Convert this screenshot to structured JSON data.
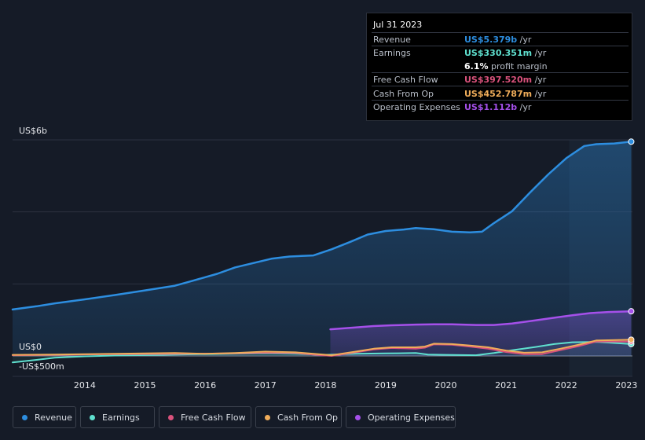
{
  "chart_data": {
    "type": "line",
    "x_ticks": [
      "2014",
      "2015",
      "2016",
      "2017",
      "2018",
      "2019",
      "2020",
      "2021",
      "2022",
      "2023"
    ],
    "y_ticks": [
      {
        "label": "US$6b",
        "value": 6000
      },
      {
        "label": "US$0",
        "value": 0
      },
      {
        "label": "-US$500m",
        "value": -500
      }
    ],
    "ylim": [
      -550,
      6000
    ],
    "xlim": [
      2013.3,
      2023.6
    ],
    "forecast_start": 2022.55,
    "series": [
      {
        "name": "Revenue",
        "color": "#2d8ee0",
        "fill": true,
        "x": [
          2013.3,
          2013.7,
          2014.0,
          2014.5,
          2015.0,
          2015.5,
          2016.0,
          2016.3,
          2016.7,
          2017.0,
          2017.3,
          2017.6,
          2017.9,
          2018.3,
          2018.6,
          2018.9,
          2019.2,
          2019.5,
          2019.8,
          2020.0,
          2020.3,
          2020.6,
          2020.9,
          2021.1,
          2021.3,
          2021.6,
          2021.9,
          2022.2,
          2022.5,
          2022.8,
          2023.0,
          2023.3,
          2023.58
        ],
        "y": [
          1290,
          1380,
          1460,
          1570,
          1690,
          1820,
          1950,
          2090,
          2280,
          2460,
          2580,
          2700,
          2760,
          2790,
          2960,
          3160,
          3370,
          3470,
          3510,
          3550,
          3520,
          3450,
          3430,
          3450,
          3690,
          4020,
          4540,
          5040,
          5490,
          5830,
          5880,
          5900,
          5950
        ]
      },
      {
        "name": "Earnings",
        "color": "#5fe0cf",
        "fill": false,
        "x": [
          2013.3,
          2013.7,
          2014.0,
          2014.5,
          2015.0,
          2015.5,
          2016.0,
          2016.5,
          2017.0,
          2017.5,
          2018.0,
          2018.5,
          2019.0,
          2019.5,
          2020.0,
          2020.2,
          2020.5,
          2021.0,
          2021.3,
          2021.6,
          2022.0,
          2022.3,
          2022.6,
          2023.0,
          2023.58
        ],
        "y": [
          -180,
          -110,
          -50,
          -10,
          10,
          25,
          40,
          50,
          60,
          70,
          60,
          30,
          60,
          70,
          80,
          40,
          30,
          20,
          80,
          160,
          250,
          330,
          380,
          390,
          330
        ]
      },
      {
        "name": "Free Cash Flow",
        "color": "#d9527c",
        "fill": false,
        "x": [
          2013.3,
          2014.0,
          2015.0,
          2016.0,
          2017.0,
          2017.5,
          2018.0,
          2018.3,
          2018.6,
          2019.0,
          2019.3,
          2019.6,
          2020.0,
          2020.15,
          2020.3,
          2020.6,
          2020.9,
          2021.2,
          2021.5,
          2021.8,
          2022.1,
          2022.4,
          2022.7,
          2023.0,
          2023.58
        ],
        "y": [
          20,
          30,
          50,
          60,
          70,
          90,
          80,
          40,
          0,
          100,
          180,
          220,
          200,
          230,
          320,
          310,
          260,
          200,
          110,
          50,
          50,
          160,
          270,
          400,
          400
        ]
      },
      {
        "name": "Cash From Op",
        "color": "#f0ad5a",
        "fill": false,
        "x": [
          2013.3,
          2014.0,
          2015.0,
          2016.0,
          2016.5,
          2017.0,
          2017.5,
          2018.0,
          2018.3,
          2018.6,
          2019.0,
          2019.3,
          2019.6,
          2020.0,
          2020.15,
          2020.3,
          2020.6,
          2020.9,
          2021.2,
          2021.5,
          2021.8,
          2022.1,
          2022.4,
          2022.7,
          2023.0,
          2023.58
        ],
        "y": [
          30,
          40,
          60,
          80,
          60,
          80,
          120,
          100,
          60,
          20,
          120,
          200,
          240,
          240,
          260,
          340,
          330,
          290,
          240,
          150,
          90,
          100,
          200,
          310,
          430,
          450
        ]
      },
      {
        "name": "Operating Expenses",
        "color": "#a550ea",
        "fill": true,
        "x": [
          2018.58,
          2019.0,
          2019.3,
          2019.6,
          2020.0,
          2020.3,
          2020.6,
          2021.0,
          2021.3,
          2021.6,
          2022.0,
          2022.3,
          2022.6,
          2022.9,
          2023.2,
          2023.58
        ],
        "y": [
          740,
          790,
          830,
          850,
          870,
          880,
          880,
          860,
          860,
          900,
          990,
          1060,
          1130,
          1190,
          1220,
          1240
        ]
      }
    ]
  },
  "tooltip": {
    "date": "Jul 31 2023",
    "rows": [
      {
        "label": "Revenue",
        "value": "US$5.379b",
        "unit": " /yr",
        "color": "#2d8ee0"
      },
      {
        "label": "Earnings",
        "value": "US$330.351m",
        "unit": " /yr",
        "color": "#5fe0cf"
      },
      {
        "label": "",
        "value": "6.1%",
        "unit": " profit margin",
        "color": "#ffffff"
      },
      {
        "label": "Free Cash Flow",
        "value": "US$397.520m",
        "unit": " /yr",
        "color": "#d9527c"
      },
      {
        "label": "Cash From Op",
        "value": "US$452.787m",
        "unit": " /yr",
        "color": "#f0ad5a"
      },
      {
        "label": "Operating Expenses",
        "value": "US$1.112b",
        "unit": " /yr",
        "color": "#a550ea"
      }
    ]
  },
  "legend": [
    {
      "label": "Revenue",
      "color": "#2d8ee0"
    },
    {
      "label": "Earnings",
      "color": "#5fe0cf"
    },
    {
      "label": "Free Cash Flow",
      "color": "#d9527c"
    },
    {
      "label": "Cash From Op",
      "color": "#f0ad5a"
    },
    {
      "label": "Operating Expenses",
      "color": "#a550ea"
    }
  ]
}
